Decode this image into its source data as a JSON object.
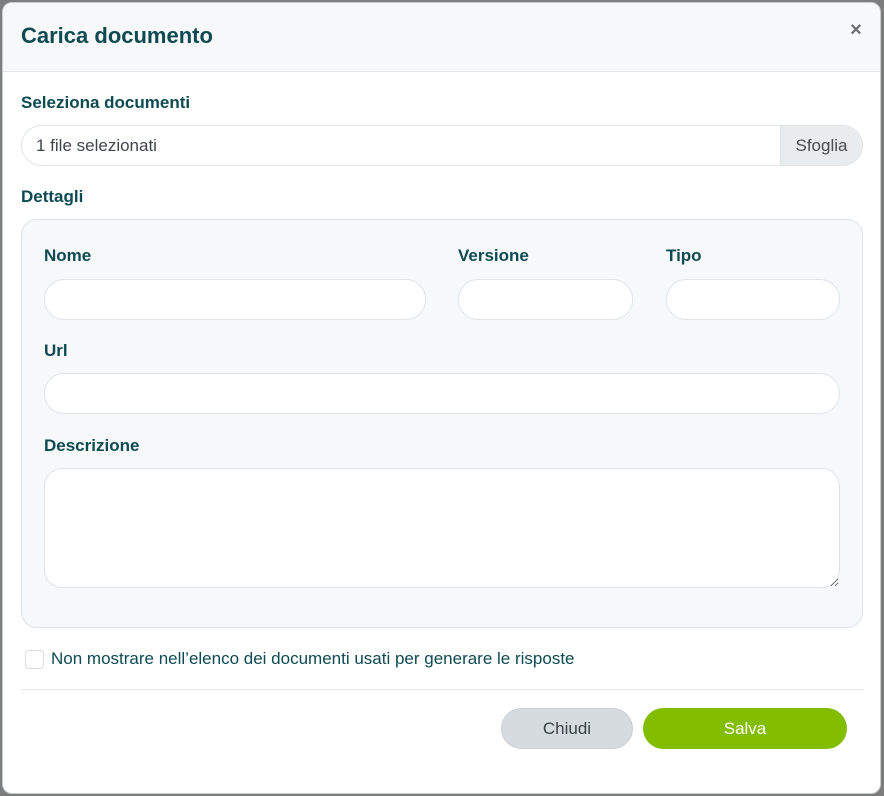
{
  "modal": {
    "title": "Carica documento",
    "close_label": "×"
  },
  "upload": {
    "label": "Seleziona documenti",
    "file_status": "1 file selezionati",
    "browse_label": "Sfoglia"
  },
  "details": {
    "section_label": "Dettagli",
    "nome": {
      "label": "Nome",
      "value": ""
    },
    "versione": {
      "label": "Versione",
      "value": ""
    },
    "tipo": {
      "label": "Tipo",
      "value": ""
    },
    "url": {
      "label": "Url",
      "value": ""
    },
    "descrizione": {
      "label": "Descrizione",
      "value": ""
    }
  },
  "option": {
    "checked": false,
    "label": "Non mostrare nell’elenco dei documenti usati per generare le risposte"
  },
  "footer": {
    "close_label": "Chiudi",
    "save_label": "Salva"
  },
  "colors": {
    "title_text": "#0d4a52",
    "save_button": "#82bd00",
    "close_button": "#d6dbe0",
    "details_background": "#f7f8f9"
  }
}
